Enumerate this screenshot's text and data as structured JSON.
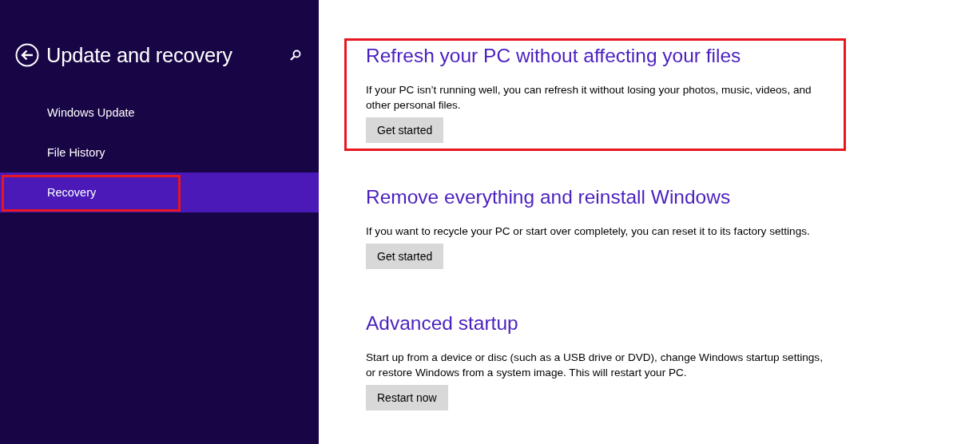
{
  "sidebar": {
    "title": "Update and recovery",
    "items": [
      {
        "label": "Windows Update",
        "selected": false,
        "highlighted": false
      },
      {
        "label": "File History",
        "selected": false,
        "highlighted": false
      },
      {
        "label": "Recovery",
        "selected": true,
        "highlighted": true
      }
    ]
  },
  "sections": [
    {
      "heading": "Refresh your PC without affecting your files",
      "description": "If your PC isn’t running well, you can refresh it without losing your photos, music, videos, and other personal files.",
      "button": "Get started",
      "highlighted": true
    },
    {
      "heading": "Remove everything and reinstall Windows",
      "description": "If you want to recycle your PC or start over completely, you can reset it to its factory settings.",
      "button": "Get started",
      "highlighted": false
    },
    {
      "heading": "Advanced startup",
      "description": "Start up from a device or disc (such as a USB drive or DVD), change Windows startup settings, or restore Windows from a system image. This will restart your PC.",
      "button": "Restart now",
      "highlighted": false
    }
  ]
}
